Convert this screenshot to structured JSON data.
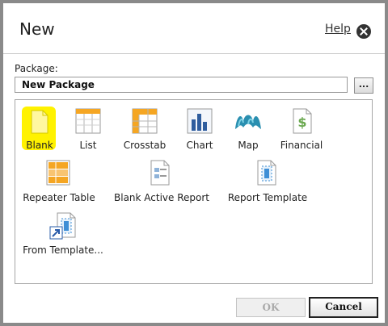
{
  "dialog": {
    "title": "New",
    "help_label": "Help",
    "close_icon": "close-circle-icon"
  },
  "package": {
    "label": "Package:",
    "value": "New Package",
    "browse_label": "..."
  },
  "tiles": {
    "blank": "Blank",
    "list": "List",
    "crosstab": "Crosstab",
    "chart": "Chart",
    "map": "Map",
    "financial": "Financial",
    "repeater_table": "Repeater Table",
    "blank_active_report": "Blank Active Report",
    "report_template": "Report Template",
    "from_template": "From Template..."
  },
  "footer": {
    "ok_label": "OK",
    "cancel_label": "Cancel"
  },
  "colors": {
    "highlight": "#fff200",
    "accent_orange": "#f5a623",
    "chart_blue": "#2f5d9e",
    "map_teal": "#2a8fb0",
    "financial_green": "#6aa84f"
  }
}
